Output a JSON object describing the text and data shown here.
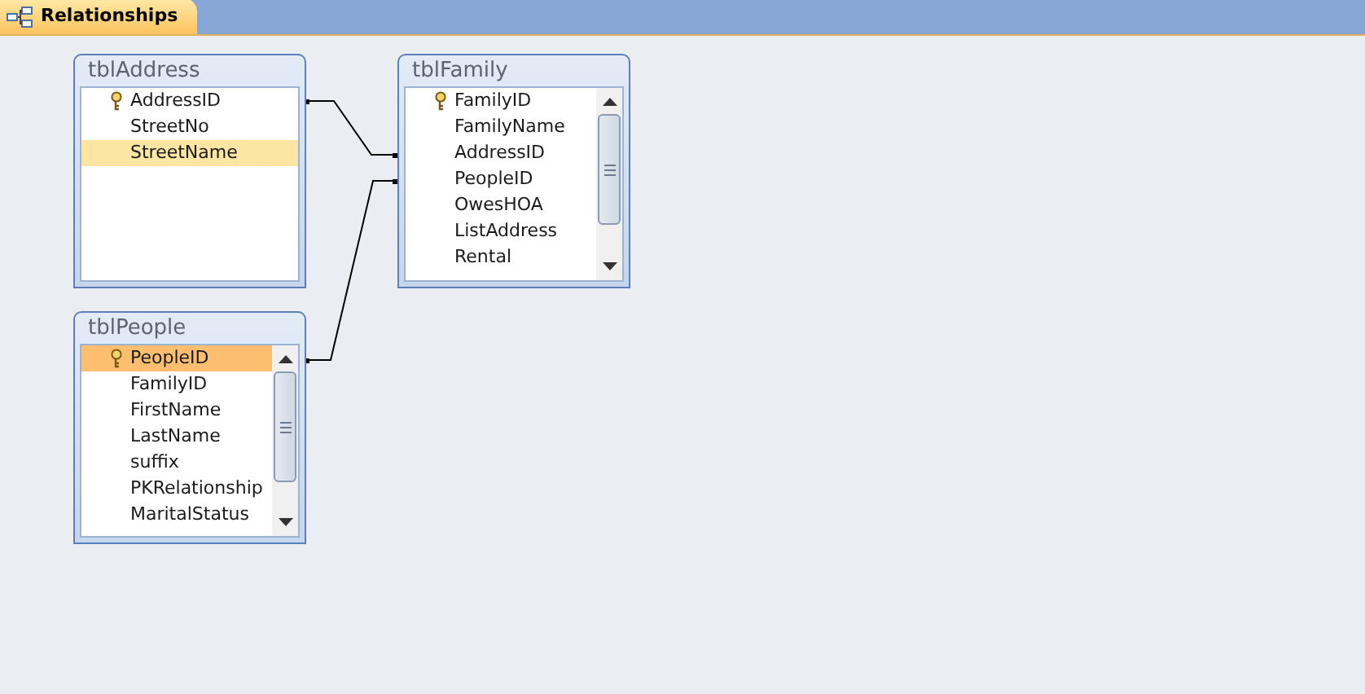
{
  "tabs": [
    {
      "label": "Relationships",
      "selected": true
    }
  ],
  "tables": [
    {
      "title": "tblAddress",
      "active": false,
      "scrollbar": false,
      "fields": [
        {
          "name": "AddressID",
          "key": true,
          "selected": false
        },
        {
          "name": "StreetNo",
          "key": false,
          "selected": false
        },
        {
          "name": "StreetName",
          "key": false,
          "selected": true
        }
      ]
    },
    {
      "title": "tblFamily",
      "scrollbar": true,
      "fields": [
        {
          "name": "FamilyID",
          "key": true,
          "selected": false
        },
        {
          "name": "FamilyName",
          "key": false,
          "selected": false
        },
        {
          "name": "AddressID",
          "key": false,
          "selected": false
        },
        {
          "name": "PeopleID",
          "key": false,
          "selected": false
        },
        {
          "name": "OwesHOA",
          "key": false,
          "selected": false
        },
        {
          "name": "ListAddress",
          "key": false,
          "selected": false
        },
        {
          "name": "Rental",
          "key": false,
          "selected": false
        }
      ]
    },
    {
      "title": "tblPeople",
      "active": true,
      "scrollbar": true,
      "fields": [
        {
          "name": "PeopleID",
          "key": true,
          "selected": true
        },
        {
          "name": "FamilyID",
          "key": false,
          "selected": false
        },
        {
          "name": "FirstName",
          "key": false,
          "selected": false
        },
        {
          "name": "LastName",
          "key": false,
          "selected": false
        },
        {
          "name": "suffix",
          "key": false,
          "selected": false
        },
        {
          "name": "PKRelationship",
          "key": false,
          "selected": false
        },
        {
          "name": "MaritalStatus",
          "key": false,
          "selected": false
        }
      ]
    }
  ]
}
